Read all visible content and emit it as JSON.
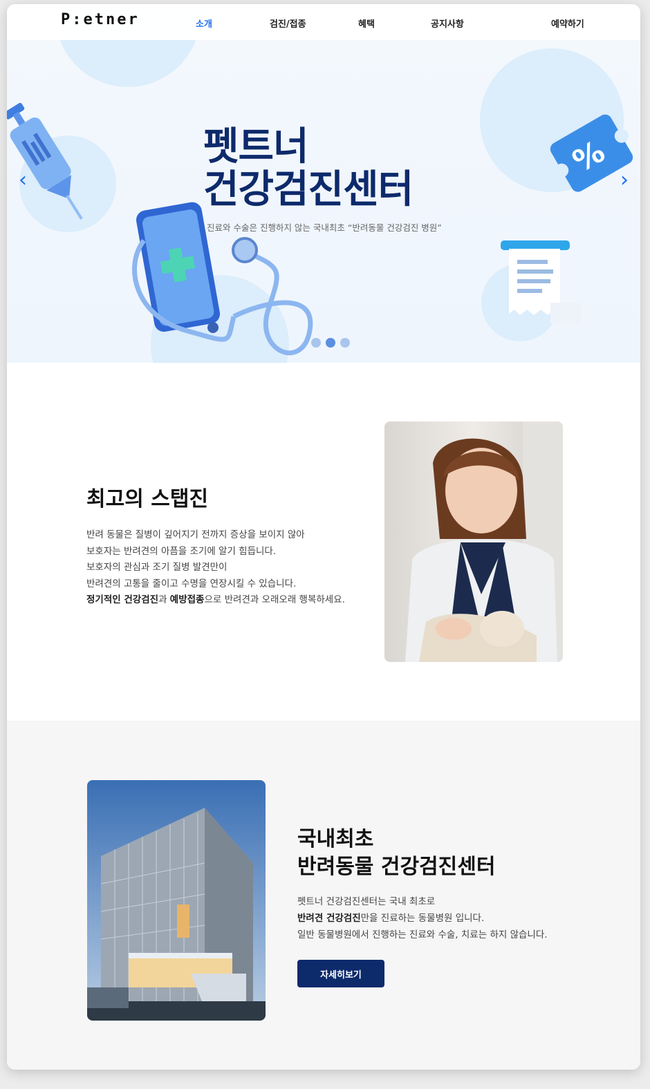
{
  "header": {
    "logo": "P:etner",
    "nav": [
      {
        "label": "소개",
        "active": true
      },
      {
        "label": "검진/접종",
        "active": false
      },
      {
        "label": "혜택",
        "active": false
      },
      {
        "label": "공지사항",
        "active": false
      }
    ],
    "reserve_label": "예약하기"
  },
  "hero": {
    "title_line1": "펫트너",
    "title_line2": "건강검진센터",
    "subtitle": "진료와 수술은 진행하지 않는 국내최초 “반려동물 건강검진 병원”",
    "prev_icon": "chevron-left-icon",
    "next_icon": "chevron-right-icon",
    "slides": {
      "count": 3,
      "current": 2
    },
    "illustrations": [
      "syringe-icon",
      "phone-stethoscope-icon",
      "discount-ticket-icon",
      "receipt-icon"
    ]
  },
  "staff_section": {
    "title": "최고의 스탭진",
    "lines": [
      "반려 동물은 질병이 깊어지기 전까지 증상을 보이지 않아",
      "보호자는 반려견의 아픔을 조기에 알기 힘듭니다.",
      "보호자의 관심과 조기 질병 발견만이",
      "반려견의 고통을 줄이고 수명을 연장시킬 수 있습니다."
    ],
    "last_line": {
      "bold1": "정기적인 건강검진",
      "text1": "과 ",
      "bold2": "예방접종",
      "text2": "으로 반려견과 오래오래 행복하세요."
    }
  },
  "center_section": {
    "title_line1": "국내최초",
    "title_line2": "반려동물 건강검진센터",
    "line1": "펫트너 건강검진센터는 국내 최초로",
    "line2_bold": "반려견 건강검진",
    "line2_text": "만을 진료하는 동물병원 입니다.",
    "line3": "일반 동물병원에서 진행하는 진료와 수술, 치료는 하지 않습니다.",
    "button_label": "자세히보기"
  },
  "colors": {
    "accent": "#1e6ff0",
    "navy": "#0d2a6b",
    "hero_bg": "#eef5fd",
    "section_gray": "#f6f6f6"
  }
}
